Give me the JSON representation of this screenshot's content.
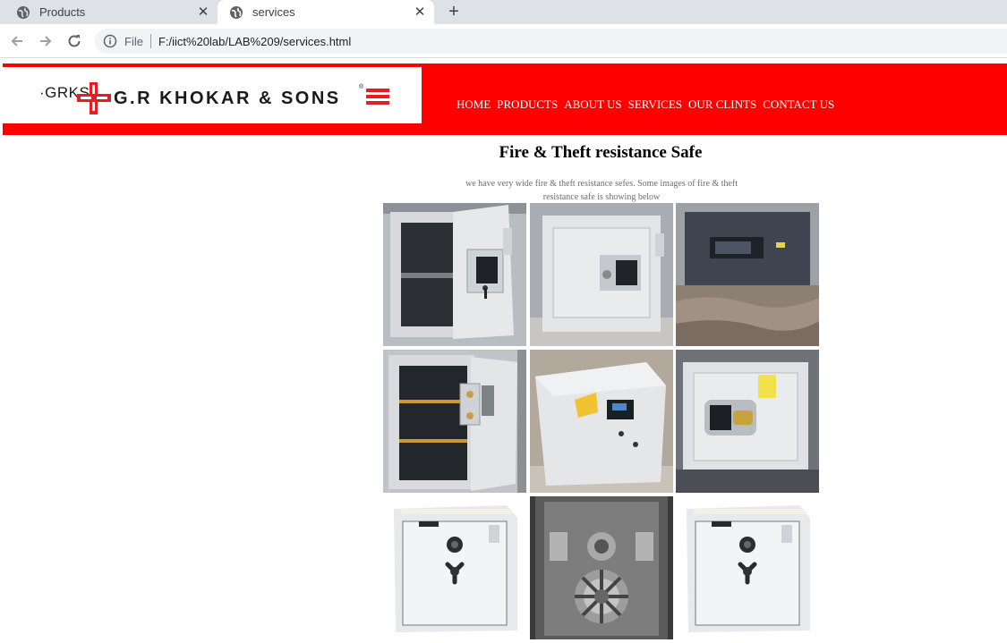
{
  "browser": {
    "tabs": [
      {
        "title": "Products"
      },
      {
        "title": "services"
      }
    ],
    "new_tab_symbol": "+",
    "close_symbol": "✕",
    "address": {
      "scheme_label": "File",
      "url": "F:/iict%20lab/LAB%209/services.html"
    }
  },
  "header": {
    "logo": {
      "abbr": "·GRKS",
      "name": "G.R KHOKAR & SONS",
      "reg": "®"
    },
    "nav": [
      "HOME",
      "PRODUCTS",
      "ABOUT US",
      "SERVICES",
      "OUR CLINTS",
      "CONTACT US"
    ]
  },
  "main": {
    "title": "Fire & Theft resistance Safe",
    "intro": "we have very wide fire & theft resistance sefes. Some images of fire & theft resistance safe is showing below"
  },
  "colors": {
    "header_bg": "#ff0000",
    "nav_text": "#ffffff",
    "logo_red": "#e31e24"
  },
  "gallery": [
    {
      "id": "safe-photo-1"
    },
    {
      "id": "safe-photo-2"
    },
    {
      "id": "safe-photo-3"
    },
    {
      "id": "safe-photo-4"
    },
    {
      "id": "safe-photo-5"
    },
    {
      "id": "safe-photo-6"
    },
    {
      "id": "safe-photo-7"
    },
    {
      "id": "safe-photo-8"
    },
    {
      "id": "safe-photo-9"
    }
  ]
}
